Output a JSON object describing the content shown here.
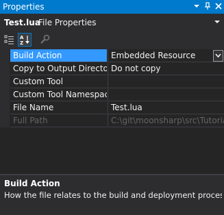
{
  "window": {
    "title": "Properties",
    "dropdown_icon": "chevron-down-icon",
    "pin_icon": "pin-icon",
    "close_icon": "close-icon"
  },
  "object_selector": {
    "name": "Test.lua",
    "type": "File Properties"
  },
  "toolbar": {
    "buttons": [
      {
        "icon": "categorized-icon",
        "active": false
      },
      {
        "icon": "alphabetical-icon",
        "active": true
      },
      {
        "icon": "property-pages-icon",
        "active": false
      }
    ]
  },
  "properties": [
    {
      "name": "Build Action",
      "value": "Embedded Resource",
      "selected": true,
      "disabled": false,
      "has_dropdown": true
    },
    {
      "name": "Copy to Output Directory",
      "value": "Do not copy",
      "selected": false,
      "disabled": false,
      "has_dropdown": false
    },
    {
      "name": "Custom Tool",
      "value": "",
      "selected": false,
      "disabled": false,
      "has_dropdown": false
    },
    {
      "name": "Custom Tool Namespace",
      "value": "",
      "selected": false,
      "disabled": false,
      "has_dropdown": false
    },
    {
      "name": "File Name",
      "value": "Test.lua",
      "selected": false,
      "disabled": false,
      "has_dropdown": false
    },
    {
      "name": "Full Path",
      "value": "C:\\git\\moonsharp\\src\\Tutorial\\",
      "selected": false,
      "disabled": true,
      "has_dropdown": false
    }
  ],
  "description": {
    "title": "Build Action",
    "text": "How the file relates to the build and deployment processes."
  },
  "colors": {
    "accent": "#007acc",
    "selection": "#3399ff",
    "background": "#2d2d30",
    "grid_background": "#252526",
    "disabled_text": "#656565"
  }
}
